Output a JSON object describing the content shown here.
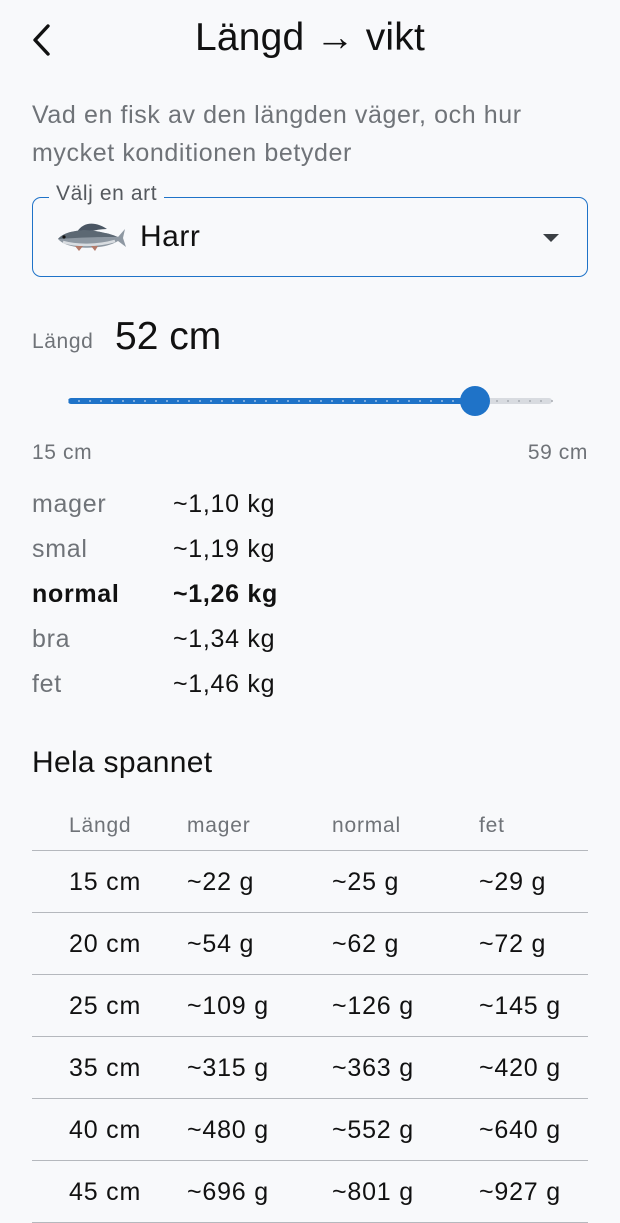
{
  "header": {
    "back_icon": "chevron-left-icon",
    "title": "Längd → vikt"
  },
  "subtitle": "Vad en fisk av den längden väger, och hur mycket konditionen betyder",
  "species_select": {
    "label": "Välj en art",
    "icon": "fish-icon",
    "value": "Harr",
    "dropdown_icon": "caret-down-icon"
  },
  "length": {
    "label": "Längd",
    "value_text": "52 cm",
    "value": 52,
    "min": 15,
    "max": 59,
    "min_label": "15 cm",
    "max_label": "59 cm",
    "accent_color": "#1f73c8"
  },
  "conditions": [
    {
      "label": "mager",
      "value": "~1,10 kg",
      "highlight": false
    },
    {
      "label": "smal",
      "value": "~1,19 kg",
      "highlight": false
    },
    {
      "label": "normal",
      "value": "~1,26 kg",
      "highlight": true
    },
    {
      "label": "bra",
      "value": "~1,34 kg",
      "highlight": false
    },
    {
      "label": "fet",
      "value": "~1,46 kg",
      "highlight": false
    }
  ],
  "range_section": {
    "title": "Hela spannet",
    "columns": [
      "Längd",
      "mager",
      "normal",
      "fet"
    ],
    "rows": [
      [
        "15 cm",
        "~22 g",
        "~25 g",
        "~29 g"
      ],
      [
        "20 cm",
        "~54 g",
        "~62 g",
        "~72 g"
      ],
      [
        "25 cm",
        "~109 g",
        "~126 g",
        "~145 g"
      ],
      [
        "35 cm",
        "~315 g",
        "~363 g",
        "~420 g"
      ],
      [
        "40 cm",
        "~480 g",
        "~552 g",
        "~640 g"
      ],
      [
        "45 cm",
        "~696 g",
        "~801 g",
        "~927 g"
      ]
    ]
  }
}
